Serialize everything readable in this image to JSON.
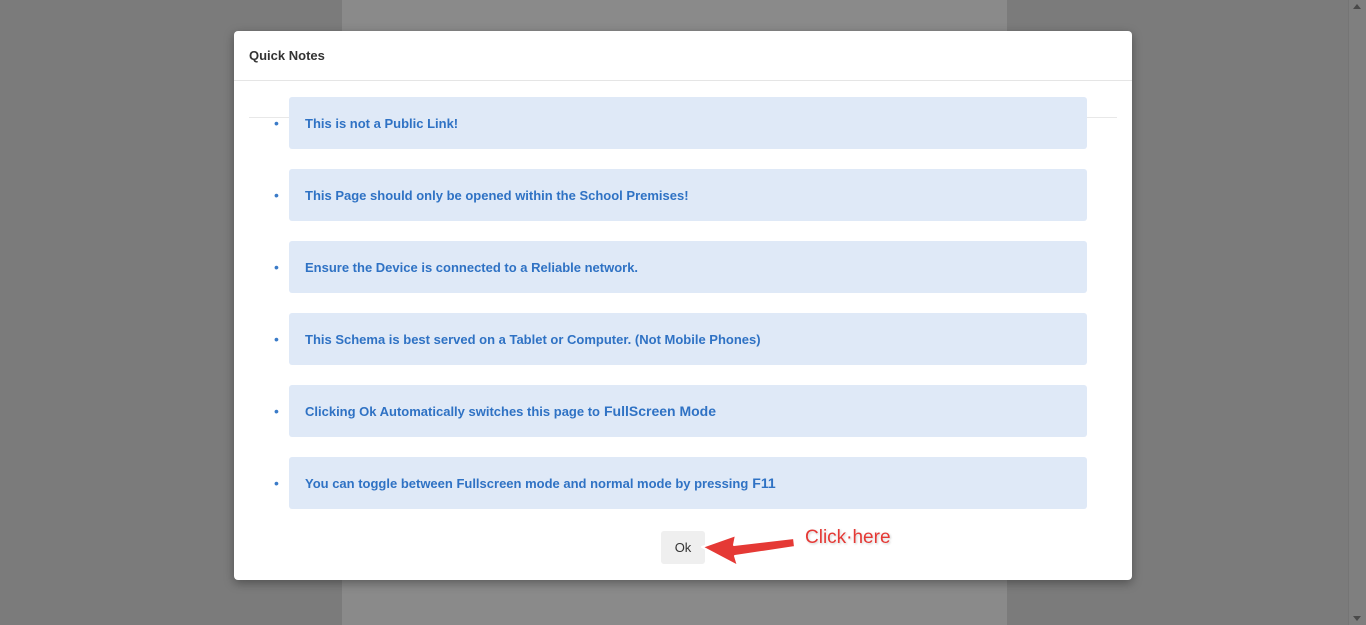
{
  "modal": {
    "title": "Quick Notes",
    "notes": [
      {
        "text": "This is not a Public Link!",
        "emphasis": ""
      },
      {
        "text": "This Page should only be opened within the School Premises!",
        "emphasis": ""
      },
      {
        "text": "Ensure the Device is connected to a Reliable network.",
        "emphasis": ""
      },
      {
        "text": "This Schema is best served on a Tablet or Computer. (Not Mobile Phones)",
        "emphasis": ""
      },
      {
        "text": "Clicking Ok Automatically switches this page to",
        "emphasis": "FullScreen Mode"
      },
      {
        "text": "You can toggle between Fullscreen mode and normal mode by pressing",
        "emphasis": "F11"
      }
    ],
    "bullet": "•",
    "ok_label": "Ok"
  },
  "annotation": {
    "label": "Click·here",
    "color": "#e53935"
  },
  "colors": {
    "note_background": "#dfe9f7",
    "note_text": "#2f72c4",
    "overlay": "#7b7b7b"
  }
}
